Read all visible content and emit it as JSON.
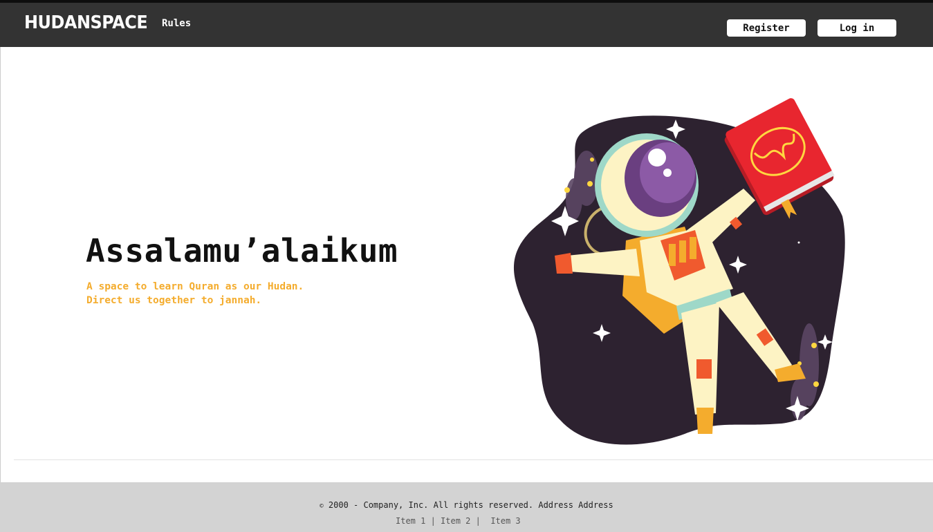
{
  "header": {
    "logo": "HUDANSPACE",
    "nav": [
      {
        "label": "Rules"
      }
    ],
    "register_label": "Register",
    "login_label": "Log in"
  },
  "hero": {
    "title": "Assalamu’alaikum",
    "subtitle_line1": "A space to learn Quran as our Hudan.",
    "subtitle_line2": "Direct us together to jannah.",
    "illustration": "astronaut-holding-quran-in-space"
  },
  "footer": {
    "copyright_symbol": "©",
    "copyright_text": " 2000 - Company, Inc. All rights reserved. Address Address",
    "links": [
      {
        "label": "Item 1"
      },
      {
        "label": "Item 2"
      },
      {
        "label": "Item 3"
      }
    ]
  },
  "colors": {
    "navbar": "#333333",
    "accent": "#f4ac2d",
    "space": "#2d2230",
    "quran": "#e02a2a",
    "footer": "#d3d3d3"
  }
}
